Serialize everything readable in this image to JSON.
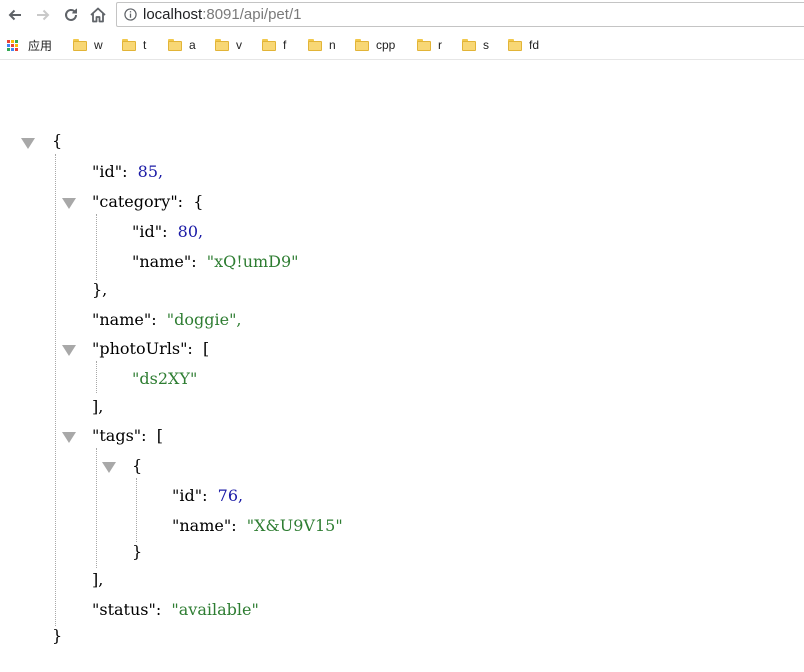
{
  "browser": {
    "url_host": "localhost",
    "url_path": ":8091/api/pet/1",
    "apps_label": "应用",
    "bookmarks": [
      "w",
      "t",
      "a",
      "v",
      "f",
      "n",
      "cpp",
      "r",
      "s",
      "fd"
    ]
  },
  "json": {
    "lines": [
      "{",
      "\"id\":",
      "85,",
      "\"category\":",
      "{",
      "\"id\":",
      "80,",
      "\"name\":",
      "\"xQ!umD9\"",
      "},",
      "\"name\":",
      "\"doggie\",",
      "\"photoUrls\":",
      "[",
      "\"ds2XY\"",
      "],",
      "\"tags\":",
      "[",
      "{",
      "\"id\":",
      "76,",
      "\"name\":",
      "\"X&U9V15\"",
      "}",
      "],",
      "\"status\":",
      "\"available\"",
      "}"
    ]
  }
}
